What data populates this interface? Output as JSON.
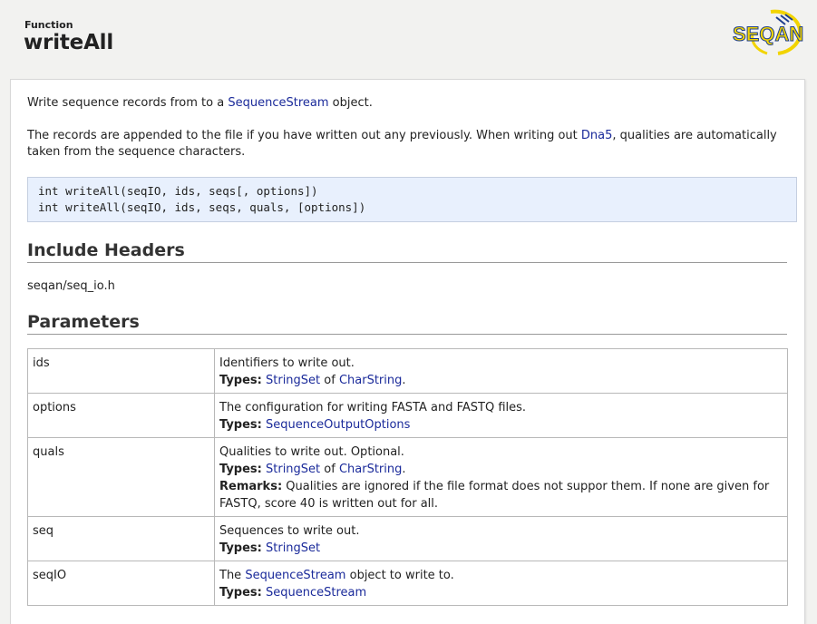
{
  "header": {
    "kind": "Function",
    "title": "writeAll",
    "logo_text": "SEQAN",
    "colors": {
      "logo_yellow": "#f2d400",
      "logo_blue": "#1f3f8f"
    }
  },
  "intro": {
    "pre": "Write sequence records from to a ",
    "link": "SequenceStream",
    "post": " object."
  },
  "description": {
    "pre": "The records are appended to the file if you have written out any previously. When writing out ",
    "link": "Dna5",
    "post": ", qualities are automatically taken from the sequence characters."
  },
  "signatures": [
    "int writeAll(seqIO, ids, seqs[, options])",
    "int writeAll(seqIO, ids, seqs, quals, [options])"
  ],
  "include": {
    "heading": "Include Headers",
    "path": "seqan/seq_io.h"
  },
  "parameters": {
    "heading": "Parameters",
    "types_label": "Types:",
    "remarks_label": "Remarks:",
    "rows": [
      {
        "name": "ids",
        "desc": "Identifiers to write out.",
        "type_a": "StringSet",
        "type_of": " of ",
        "type_b": "CharString",
        "type_end": "."
      },
      {
        "name": "options",
        "desc": "The configuration for writing FASTA and FASTQ files.",
        "type_a": "SequenceOutputOptions"
      },
      {
        "name": "quals",
        "desc": "Qualities to write out. Optional.",
        "type_a": "StringSet",
        "type_of": " of ",
        "type_b": "CharString",
        "type_end": ".",
        "remarks": "Qualities are ignored if the file format does not suppor them. If none are given for FASTQ, score 40 is written out for all."
      },
      {
        "name": "seq",
        "desc": "Sequences to write out.",
        "type_a": "StringSet"
      },
      {
        "name": "seqIO",
        "desc_pre": "The ",
        "desc_link": "SequenceStream",
        "desc_post": " object to write to.",
        "type_a": "SequenceStream"
      }
    ]
  }
}
